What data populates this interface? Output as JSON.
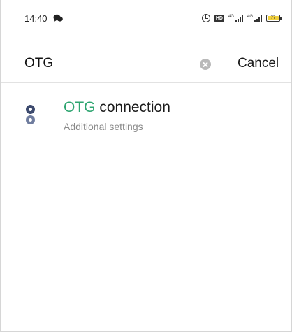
{
  "status_bar": {
    "time": "14:40",
    "left_icons": [
      "chat-bubble-icon"
    ],
    "right_icons": [
      "alarm-icon",
      "hd-icon",
      "signal-icon",
      "signal-icon",
      "battery-icon"
    ],
    "hd_label": "HD",
    "signal_label": "4G",
    "battery_level": "77"
  },
  "search": {
    "query": "OTG",
    "cancel_label": "Cancel"
  },
  "results": [
    {
      "title_highlight": "OTG",
      "title_rest": " connection",
      "subtitle": "Additional settings",
      "icon": "settings-dots-icon"
    }
  ],
  "colors": {
    "highlight": "#2fa571",
    "icon_dark": "#3d4a6e",
    "icon_light": "#6f7c9e",
    "subtitle": "#8a8a8a"
  }
}
